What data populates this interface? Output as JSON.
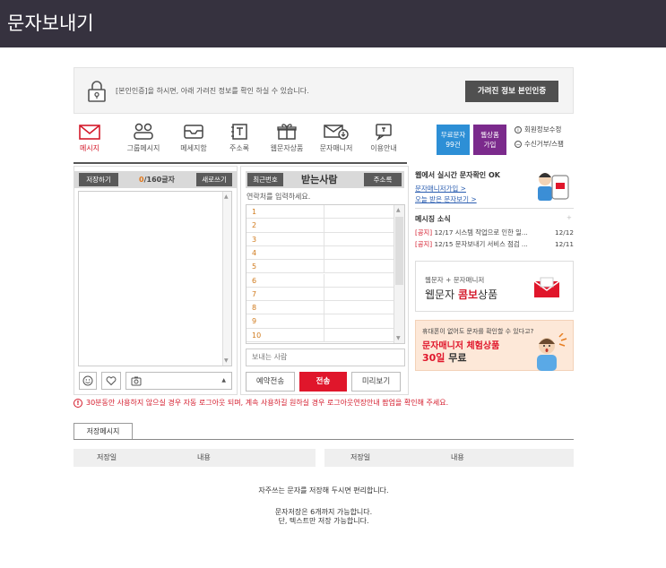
{
  "title": "문자보내기",
  "notice": {
    "text": "[본인인증]을 하시면, 아래 가려진 정보를 확인 하실 수 있습니다.",
    "button": "가려진 정보 본인인증"
  },
  "tabs": [
    {
      "label": "메시지",
      "icon": "mail-icon",
      "active": true
    },
    {
      "label": "그룹메시지",
      "icon": "group-icon",
      "active": false
    },
    {
      "label": "메세지함",
      "icon": "inbox-icon",
      "active": false
    },
    {
      "label": "주소록",
      "icon": "address-book-icon",
      "active": false
    },
    {
      "label": "웹문자상품",
      "icon": "gift-icon",
      "active": false
    },
    {
      "label": "문자매니저",
      "icon": "mail-download-icon",
      "active": false
    },
    {
      "label": "이용안내",
      "icon": "chat-help-icon",
      "active": false
    }
  ],
  "promos": {
    "free": "무료문자\n99건",
    "product": "웹상품\n가입"
  },
  "side_links": {
    "member_info": "회원정보수정",
    "reject": "수신거부/스팸"
  },
  "compose": {
    "save_button": "저장하기",
    "count_current": "0",
    "count_max": "/160글자",
    "refresh_button": "새로쓰기"
  },
  "recipients": {
    "recent_button": "최근번호",
    "title": "받는사람",
    "address_button": "주소록",
    "placeholder": "연락처를 입력하세요.",
    "rows": [
      "1",
      "2",
      "3",
      "4",
      "5",
      "6",
      "7",
      "8",
      "9",
      "10"
    ],
    "sender_label": "보내는 사람"
  },
  "actions": {
    "reserve": "예약전송",
    "send": "전송",
    "preview": "미리보기"
  },
  "right": {
    "web_title": "웹에서 실시간 문자확인 OK",
    "link1": "문자매니저가입 >",
    "link2": "오늘 받은 문자보기 >",
    "news_title": "메시징 소식",
    "news": [
      {
        "tag": "[공지]",
        "text": " 12/17 시스템 작업으로 인한 일...",
        "date": "12/12"
      },
      {
        "tag": "[공지]",
        "text": " 12/15 문자보내기 서비스 점검 ...",
        "date": "12/11"
      }
    ],
    "ad1_small": "웹문자 + 문자매니저",
    "ad1_big_a": "웹문자 ",
    "ad1_big_b": "콤보",
    "ad1_big_c": "상품",
    "ad2_small": "휴대폰이 없어도 문자를 확인할 수 있다고?",
    "ad2_line1": "문자매니저 체험상품",
    "ad2_line2a": "30일",
    "ad2_line2b": " 무료"
  },
  "warning": "30분동안 사용하지 않으실 경우 자동 로그아웃 되며, 계속 사용하길 원하실 경우 로그아웃연장안내 팝업을 확인해 주세요.",
  "saved": {
    "tab": "저장메시지",
    "col_date": "저장일",
    "col_content": "내용",
    "msg1": "자주쓰는 문자를 저장해 두시면 편리합니다.",
    "msg2": "문자저장은 6개까지 가능합니다.",
    "msg3": "단, 텍스트만 저장 가능합니다."
  },
  "colors": {
    "titlebar": "#36323f",
    "accent_red": "#d41a2b",
    "promo_blue": "#2d8fd6",
    "promo_purple": "#7b2a8c"
  }
}
